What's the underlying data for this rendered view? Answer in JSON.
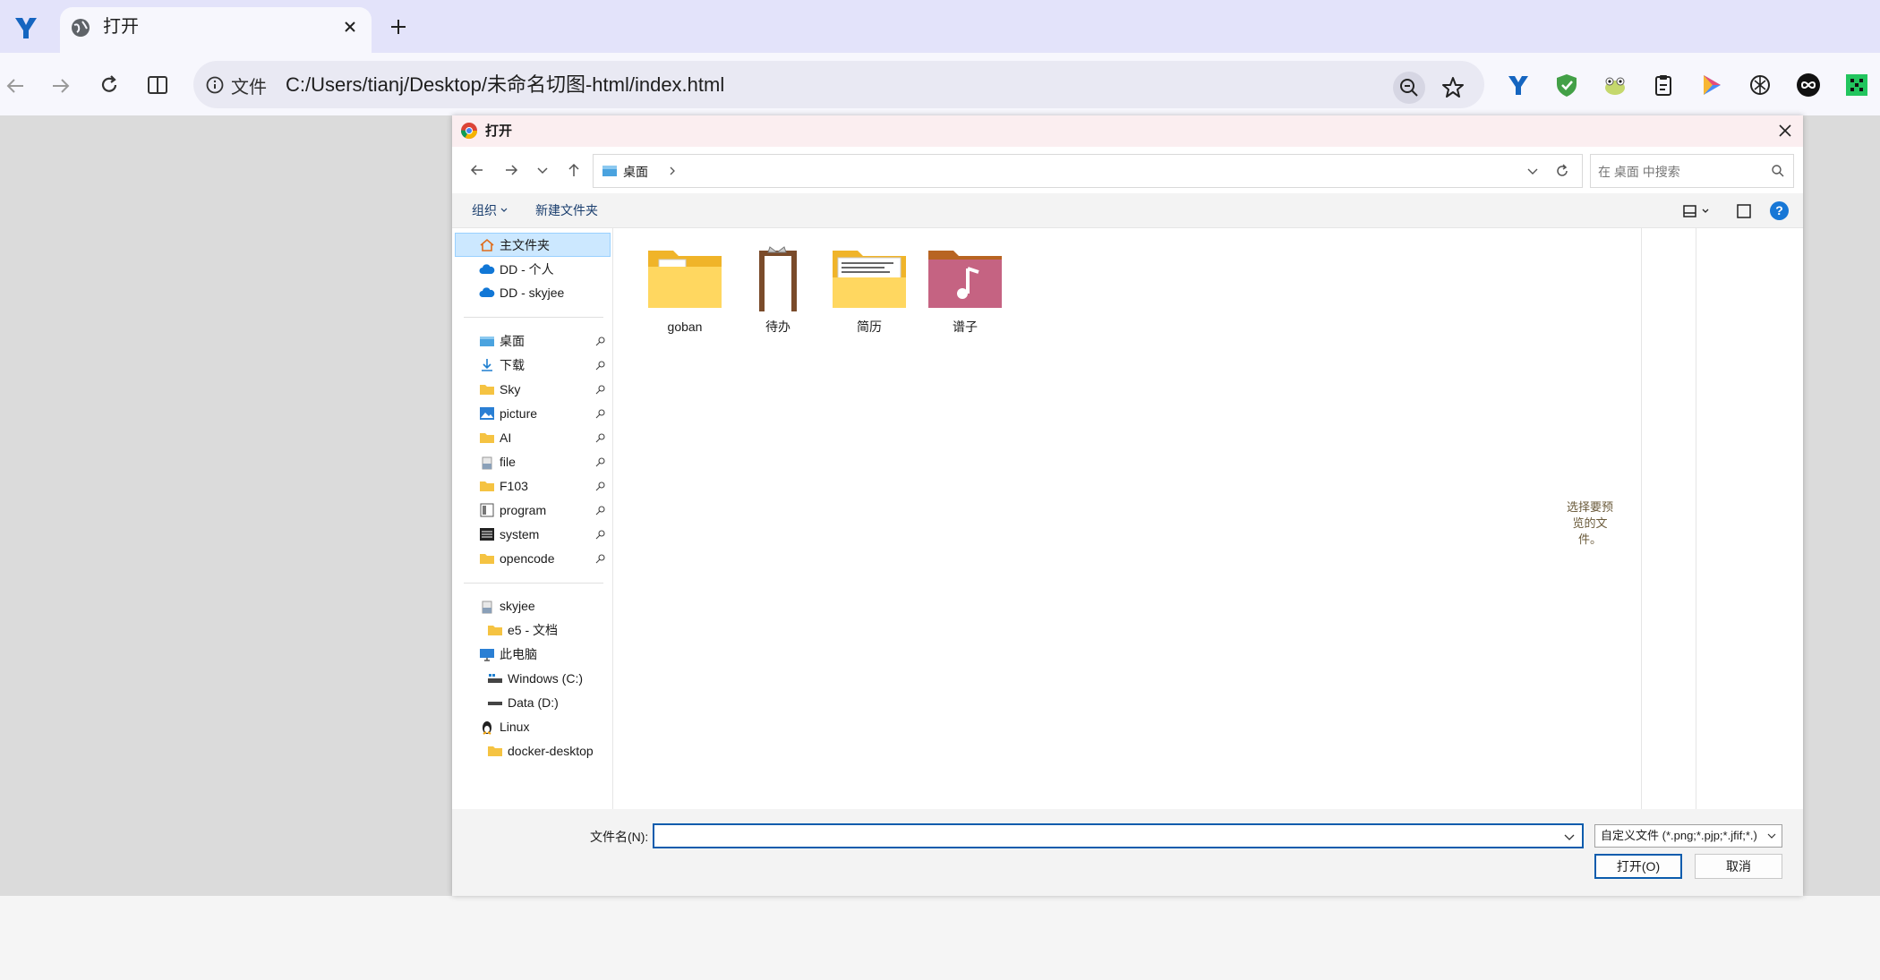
{
  "browser": {
    "tab_title": "打开",
    "site_info_label": "文件",
    "url": "C:/Users/tianj/Desktop/未命名切图-html/index.html",
    "accent": "#1777d6"
  },
  "dialog": {
    "title": "打开",
    "address_segment": "桌面",
    "search_placeholder": "在 桌面 中搜索",
    "organize_label": "组织",
    "new_folder_label": "新建文件夹",
    "help_label": "?",
    "nav": {
      "home": "主文件夹",
      "dd_personal": "DD - 个人",
      "dd_skyjee": "DD - skyjee",
      "quick_access": [
        "桌面",
        "下载",
        "Sky",
        "picture",
        "AI",
        "file",
        "F103",
        "program",
        "system",
        "opencode"
      ],
      "skyjee": "skyjee",
      "e5_docs": "e5 - 文档",
      "this_pc": "此电脑",
      "windows_c": "Windows (C:)",
      "data_d": "Data (D:)",
      "linux": "Linux",
      "docker_desktop": "docker-desktop"
    },
    "files": [
      "goban",
      "待办",
      "简历",
      "谱子"
    ],
    "preview_text": "选择要预览的文件。",
    "filename_label": "文件名(N):",
    "filename_value": "",
    "file_type_filter": "自定义文件 (*.png;*.pjp;*.jfif;*.)",
    "open_button": "打开(O)",
    "cancel_button": "取消"
  }
}
